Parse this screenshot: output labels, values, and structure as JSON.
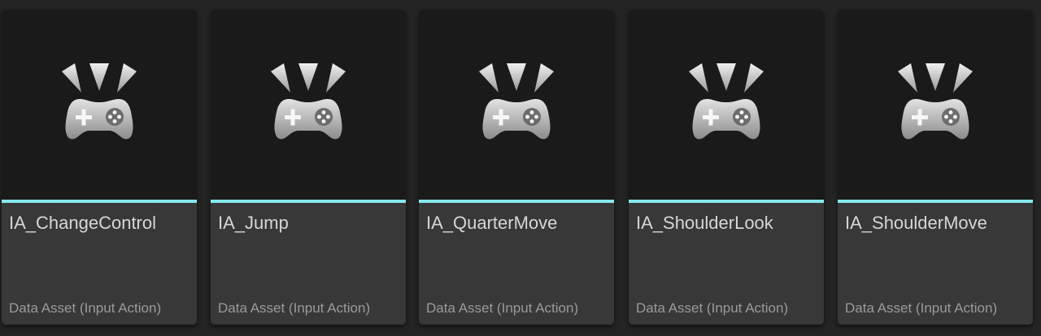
{
  "colors": {
    "accent": "#86e8ec",
    "tile_body": "#383838",
    "thumbnail_bg": "#1a1a1a"
  },
  "assets": [
    {
      "name": "IA_ChangeControl",
      "type": "Data Asset (Input Action)",
      "icon": "gamepad-icon"
    },
    {
      "name": "IA_Jump",
      "type": "Data Asset (Input Action)",
      "icon": "gamepad-icon"
    },
    {
      "name": "IA_QuarterMove",
      "type": "Data Asset (Input Action)",
      "icon": "gamepad-icon"
    },
    {
      "name": "IA_ShoulderLook",
      "type": "Data Asset (Input Action)",
      "icon": "gamepad-icon"
    },
    {
      "name": "IA_ShoulderMove",
      "type": "Data Asset (Input Action)",
      "icon": "gamepad-icon"
    }
  ]
}
